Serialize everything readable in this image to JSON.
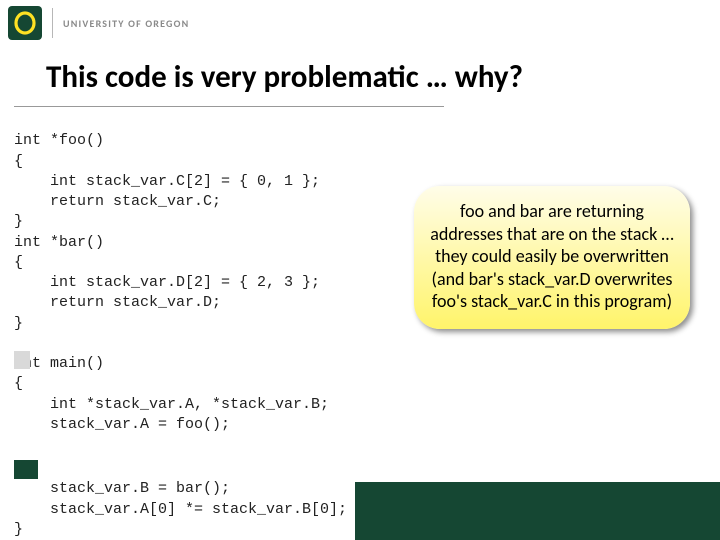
{
  "brand": {
    "name": "UNIVERSITY OF OREGON"
  },
  "title": "This code is very problematic … why?",
  "code": {
    "l1": "int *foo()",
    "l2": "{",
    "l3": "    int stack_var.C[2] = { 0, 1 };",
    "l4": "    return stack_var.C;",
    "l5": "}",
    "l6": "int *bar()",
    "l7": "{",
    "l8": "    int stack_var.D[2] = { 2, 3 };",
    "l9": "    return stack_var.D;",
    "l10": "}",
    "l11": "",
    "l12": "int main()",
    "l13": "{",
    "l14": "    int *stack_var.A, *stack_var.B;",
    "l15": "    stack_var.A = foo();",
    "l16": "    stack_var.B = bar();",
    "l17": "    stack_var.A[0] *= stack_var.B[0];",
    "l18": "}"
  },
  "callout": {
    "text": "foo and bar are returning addresses that are on the stack … they could easily be overwritten\n(and bar's stack_var.D overwrites foo's stack_var.C in this program)"
  }
}
